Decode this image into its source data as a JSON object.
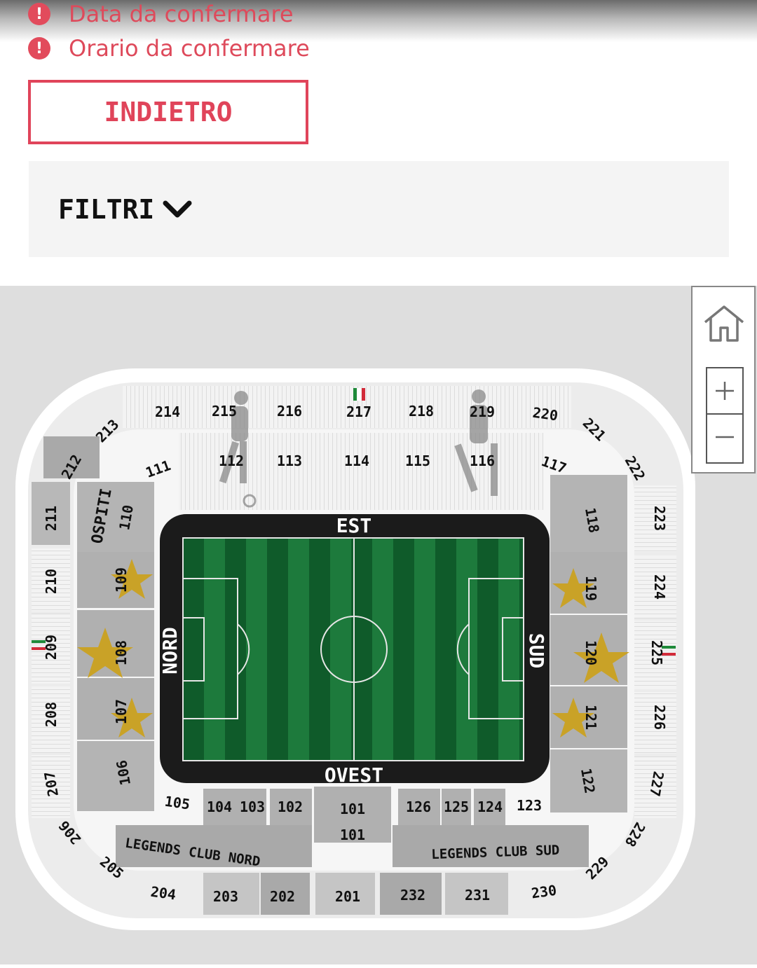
{
  "notices": [
    {
      "icon": "alert-icon",
      "text": "Data da confermare"
    },
    {
      "icon": "alert-icon",
      "text": "Orario da confermare"
    }
  ],
  "back_button": {
    "label": "INDIETRO"
  },
  "filters": {
    "label": "FILTRI",
    "icon": "chevron-down-icon"
  },
  "colors": {
    "accent": "#e0445a",
    "section": "#a9a9a9",
    "pitch_dark": "#0f5b2a",
    "pitch_light": "#1d7a3c",
    "star": "#c9a227"
  },
  "map_controls": {
    "home_icon": "home-icon",
    "zoom_in_icon": "plus-icon",
    "zoom_out_icon": "minus-icon"
  },
  "stadium": {
    "stands": {
      "east": "EST",
      "west": "OVEST",
      "north": "NORD",
      "south": "SUD"
    },
    "labels": {
      "ospiti": "OSPITI",
      "legends_nord": "LEGENDS CLUB NORD",
      "legends_sud": "LEGENDS CLUB SUD"
    },
    "sections": {
      "s101": "101",
      "s101b": "101",
      "s102": "102",
      "s103": "103",
      "s104": "104",
      "s105": "105",
      "s106": "106",
      "s107": "107",
      "s108": "108",
      "s109": "109",
      "s110": "110",
      "s111": "111",
      "s112": "112",
      "s113": "113",
      "s114": "114",
      "s115": "115",
      "s116": "116",
      "s117": "117",
      "s118": "118",
      "s119": "119",
      "s120": "120",
      "s121": "121",
      "s122": "122",
      "s123": "123",
      "s124": "124",
      "s125": "125",
      "s126": "126",
      "s201": "201",
      "s202": "202",
      "s203": "203",
      "s204": "204",
      "s205": "205",
      "s206": "206",
      "s207": "207",
      "s208": "208",
      "s209": "209",
      "s210": "210",
      "s211": "211",
      "s212": "212",
      "s213": "213",
      "s214": "214",
      "s215": "215",
      "s216": "216",
      "s217": "217",
      "s218": "218",
      "s219": "219",
      "s220": "220",
      "s221": "221",
      "s222": "222",
      "s223": "223",
      "s224": "224",
      "s225": "225",
      "s226": "226",
      "s227": "227",
      "s228": "228",
      "s229": "229",
      "s230": "230",
      "s231": "231",
      "s232": "232"
    }
  }
}
